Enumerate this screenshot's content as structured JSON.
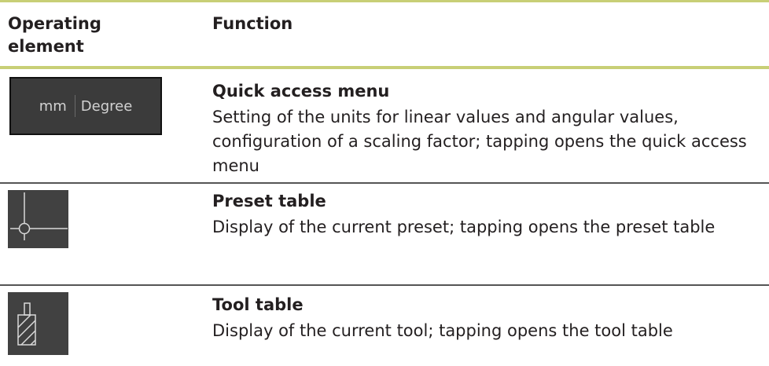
{
  "header": {
    "operating_element": "Operating element",
    "operating_line1": "Operating",
    "operating_line2": "element",
    "function": "Function"
  },
  "rows": [
    {
      "title": "Quick access menu",
      "description": "Setting of the units for linear values and angular values, configuration of a scaling factor; tapping opens the quick access menu",
      "control": {
        "unit_linear": "mm",
        "unit_angular": "Degree"
      }
    },
    {
      "title": "Preset table",
      "description": "Display of the current preset; tapping opens the preset table",
      "icon": "preset-crosshair-icon"
    },
    {
      "title": "Tool table",
      "description": "Display of the current tool; tapping opens the tool table",
      "icon": "tool-mill-icon"
    }
  ],
  "colors": {
    "rule": "#c8cf76",
    "divider": "#555555",
    "icon_bg": "#414141",
    "icon_stroke": "#d9d9d9"
  }
}
